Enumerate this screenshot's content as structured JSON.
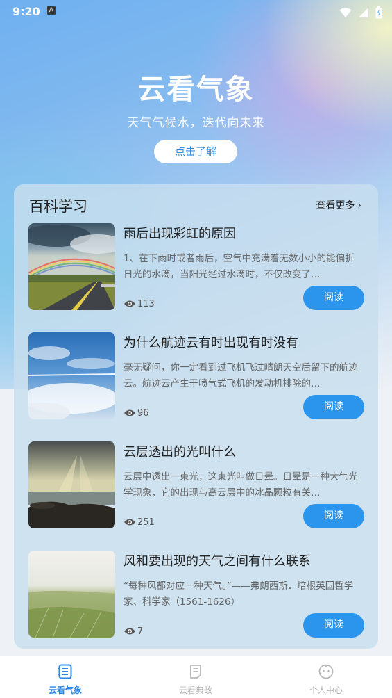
{
  "status_bar": {
    "time": "9:20",
    "notification_icon_text": "A"
  },
  "hero": {
    "title": "云看气象",
    "subtitle": "天气气候水，迭代向未来",
    "button_label": "点击了解"
  },
  "section": {
    "title": "百科学习",
    "more_label": "查看更多"
  },
  "articles": [
    {
      "title": "雨后出现彩虹的原因",
      "desc": "1、在下雨时或者雨后，空气中充满着无数小小的能偏折日光的水滴，当阳光经过水滴时，不仅改变了…",
      "views": "113",
      "read_label": "阅读",
      "thumb": "rainbow-road"
    },
    {
      "title": "为什么航迹云有时出现有时没有",
      "desc": "毫无疑问，你一定看到过飞机飞过晴朗天空后留下的航迹云。航迹云产生于喷气式飞机的发动机排除的…",
      "views": "96",
      "read_label": "阅读",
      "thumb": "contrail-sky"
    },
    {
      "title": "云层透出的光叫什么",
      "desc": "云层中透出一束光，这束光叫做日晕。日晕是一种大气光学现象，它的出现与高云层中的冰晶颗粒有关…",
      "views": "251",
      "read_label": "阅读",
      "thumb": "sunbeam-sea"
    },
    {
      "title": "风和要出现的天气之间有什么联系",
      "desc": "“每种风都对应一种天气。”——弗朗西斯．培根英国哲学家、科学家（1561-1626）",
      "views": "7",
      "read_label": "阅读",
      "thumb": "wind-grass"
    }
  ],
  "tabs": [
    {
      "label": "云看气象",
      "icon": "book-icon",
      "active": true
    },
    {
      "label": "云看典故",
      "icon": "note-icon",
      "active": false
    },
    {
      "label": "个人中心",
      "icon": "smile-face-icon",
      "active": false
    }
  ],
  "colors": {
    "accent": "#2b95ee",
    "tab_active": "#2b86e6",
    "tab_inactive": "#b7b7b7"
  }
}
